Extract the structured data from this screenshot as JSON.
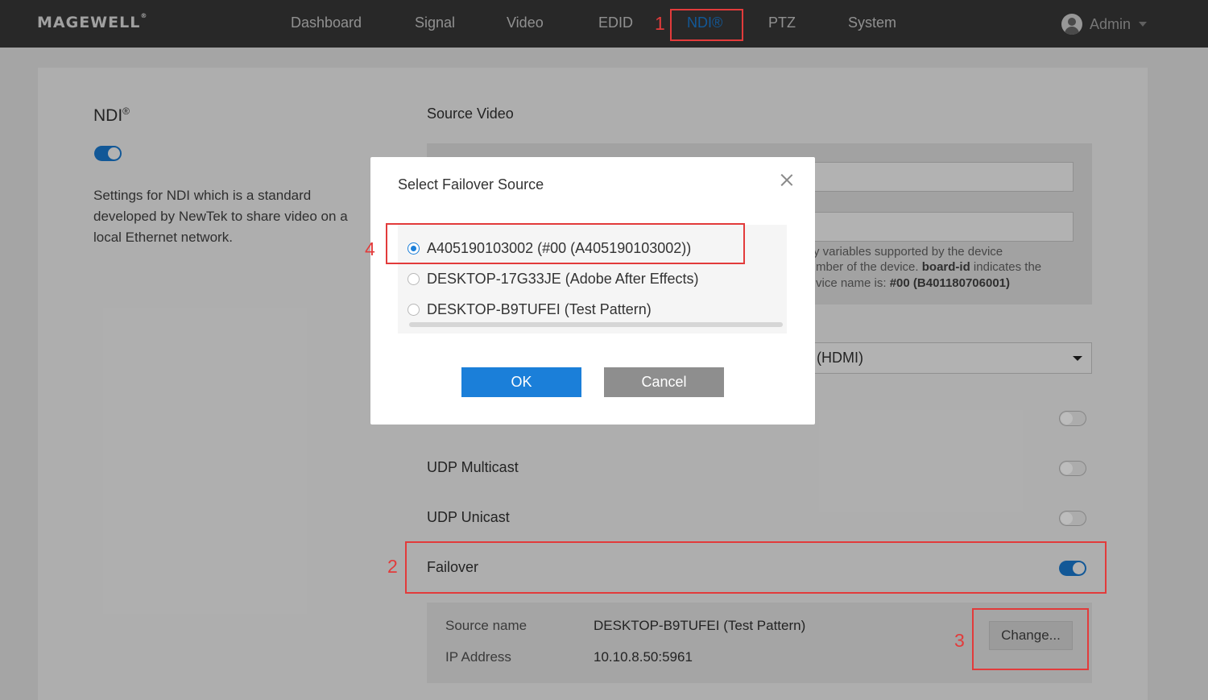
{
  "brand": {
    "logo": "MAGEWELL",
    "reg": "®"
  },
  "nav": {
    "items": [
      {
        "label": "Dashboard"
      },
      {
        "label": "Signal"
      },
      {
        "label": "Video"
      },
      {
        "label": "EDID"
      },
      {
        "label": "NDI®"
      },
      {
        "label": "PTZ"
      },
      {
        "label": "System"
      }
    ],
    "active": "NDI®",
    "user": "Admin"
  },
  "left": {
    "title": "NDI",
    "title_sup": "®",
    "ndi_enabled": true,
    "description": "Settings for NDI which is a standard developed by NewTek to share video on a local Ethernet network."
  },
  "right": {
    "section_title": "Source Video",
    "hint_line1": "only variables supported by the device",
    "hint_line2_a": "mber of the device.",
    "hint_line2_b": "board-id",
    "hint_line2_c": "indicates the",
    "hint_line3_a": "vice name is:",
    "hint_line3_b": "#00 (B401180706001)",
    "select_value": "(HDMI)",
    "rows": [
      {
        "label": "UDP Multicast",
        "enabled": false
      },
      {
        "label": "UDP Unicast",
        "enabled": false
      },
      {
        "label": "Failover",
        "enabled": true
      }
    ],
    "failover": {
      "source_name_label": "Source name",
      "source_name_value": "DESKTOP-B9TUFEI (Test Pattern)",
      "ip_label": "IP Address",
      "ip_value": "10.10.8.50:5961",
      "change_label": "Change..."
    }
  },
  "annotations": [
    "1",
    "2",
    "3",
    "4"
  ],
  "modal": {
    "title": "Select Failover Source",
    "options": [
      {
        "label": "A405190103002 (#00 (A405190103002))",
        "selected": true
      },
      {
        "label": "DESKTOP-17G33JE (Adobe After Effects)",
        "selected": false
      },
      {
        "label": "DESKTOP-B9TUFEI (Test Pattern)",
        "selected": false
      }
    ],
    "ok_label": "OK",
    "cancel_label": "Cancel"
  },
  "colors": {
    "accent": "#1b7fd9",
    "annotation": "#e23b3b",
    "topbar": "#3a3a3a"
  }
}
